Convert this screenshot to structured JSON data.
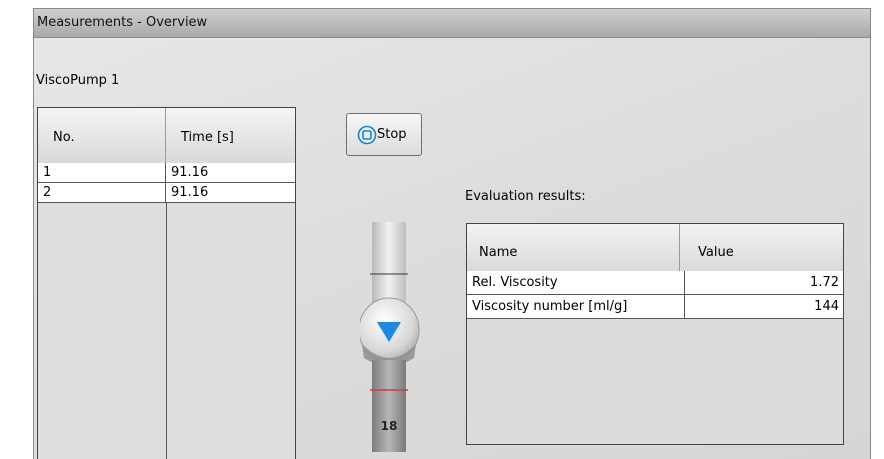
{
  "window": {
    "title": "Measurements - Overview"
  },
  "device": {
    "name": "ViscoPump  1"
  },
  "measurements": {
    "headers": [
      "No.",
      "Time [s]"
    ],
    "rows": [
      {
        "no": "1",
        "time": "91.16"
      },
      {
        "no": "2",
        "time": "91.16"
      }
    ]
  },
  "controls": {
    "stop_label": "Stop",
    "stop_icon": "stop-icon"
  },
  "pump": {
    "counter": "18",
    "direction": "down",
    "arrow_color": "#1e88e5"
  },
  "evaluation": {
    "label": "Evaluation results:",
    "headers": [
      "Name",
      "Value"
    ],
    "rows": [
      {
        "name": "Rel. Viscosity",
        "value": "1.72"
      },
      {
        "name": "Viscosity number [ml/g]",
        "value": "144"
      }
    ]
  }
}
